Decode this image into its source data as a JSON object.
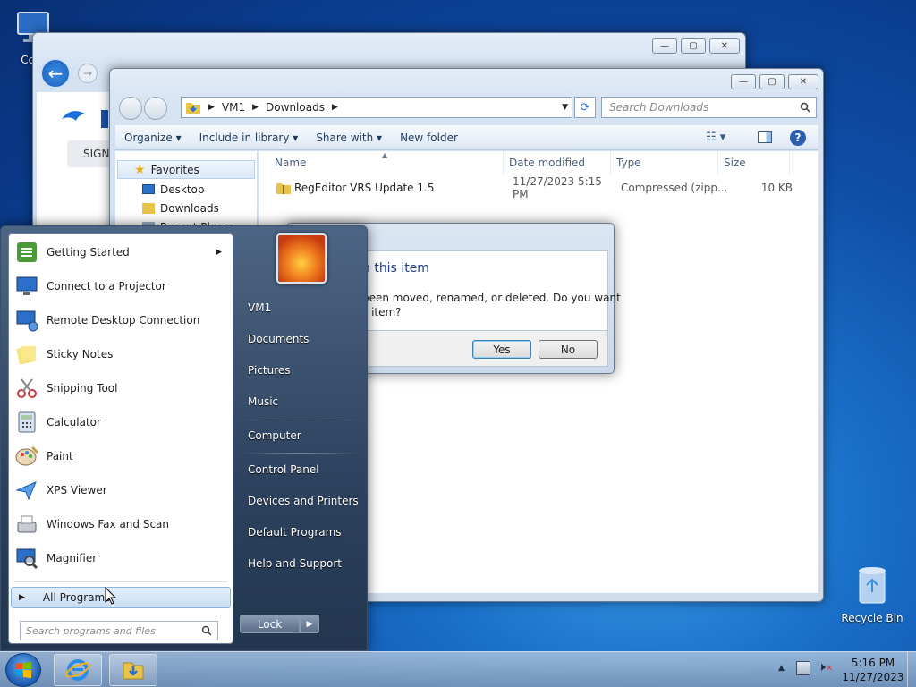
{
  "desktop": {
    "computer_label": "Com",
    "recycle_label": "Recycle Bin"
  },
  "browser": {
    "sign_label": "SIGN"
  },
  "explorer": {
    "path": [
      "VM1",
      "Downloads"
    ],
    "search_placeholder": "Search Downloads",
    "commands": [
      "Organize",
      "Include in library",
      "Share with",
      "New folder"
    ],
    "nav": {
      "favorites": "Favorites",
      "items": [
        "Desktop",
        "Downloads",
        "Recent Places"
      ]
    },
    "columns": [
      "Name",
      "Date modified",
      "Type",
      "Size"
    ],
    "files": [
      {
        "name": "RegEditor VRS Update 1.5",
        "date": "11/27/2023 5:15 PM",
        "type": "Compressed (zipp...",
        "size": "10 KB"
      }
    ]
  },
  "dialog": {
    "title": "n this item",
    "message_line1": "been moved, renamed, or deleted. Do you want",
    "message_line2": "s item?",
    "yes_label": "Yes",
    "no_label": "No"
  },
  "start_menu": {
    "programs": [
      {
        "label": "Getting Started",
        "icon": "getting-started-icon",
        "arrow": true
      },
      {
        "label": "Connect to a Projector",
        "icon": "projector-icon"
      },
      {
        "label": "Remote Desktop Connection",
        "icon": "remote-desktop-icon"
      },
      {
        "label": "Sticky Notes",
        "icon": "sticky-notes-icon"
      },
      {
        "label": "Snipping Tool",
        "icon": "scissors-icon"
      },
      {
        "label": "Calculator",
        "icon": "calculator-icon"
      },
      {
        "label": "Paint",
        "icon": "paint-palette-icon"
      },
      {
        "label": "XPS Viewer",
        "icon": "xps-icon"
      },
      {
        "label": "Windows Fax and Scan",
        "icon": "fax-icon"
      },
      {
        "label": "Magnifier",
        "icon": "magnifier-icon"
      }
    ],
    "all_programs": "All Programs",
    "search_placeholder": "Search programs and files",
    "right_items": [
      "VM1",
      "Documents",
      "Pictures",
      "Music",
      "Computer",
      "Control Panel",
      "Devices and Printers",
      "Default Programs",
      "Help and Support"
    ],
    "lock_label": "Lock"
  },
  "taskbar": {
    "time": "5:16 PM",
    "date": "11/27/2023"
  }
}
